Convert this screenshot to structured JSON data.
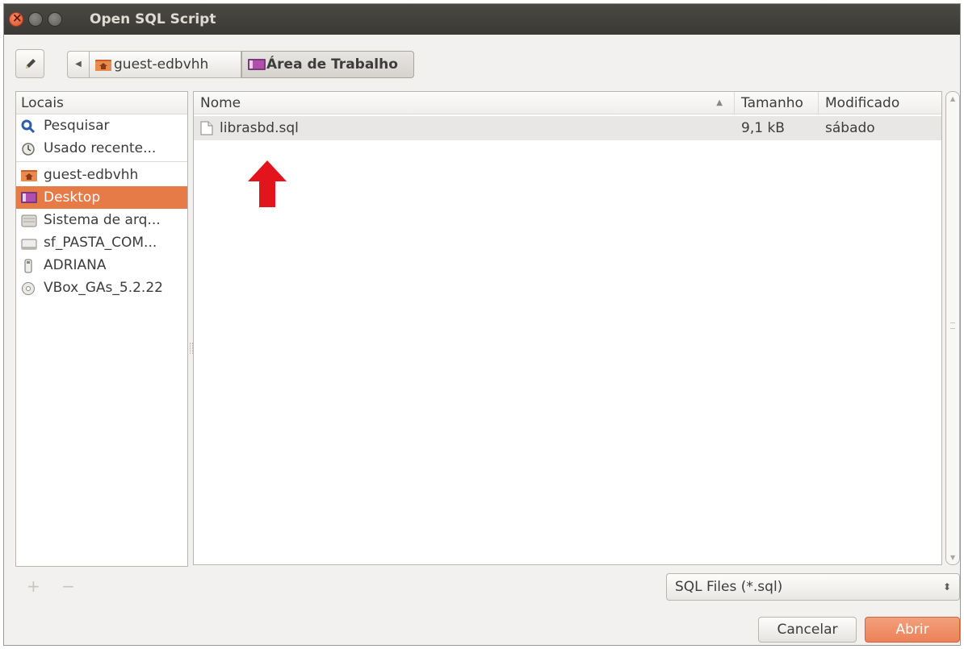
{
  "window": {
    "title": "Open SQL Script"
  },
  "pathbar": {
    "crumbs": [
      "guest-edbvhh",
      "Área de Trabalho"
    ]
  },
  "places": {
    "header": "Locais",
    "items": [
      {
        "label": "Pesquisar",
        "icon": "search-icon"
      },
      {
        "label": "Usado recente...",
        "icon": "recent-icon"
      },
      {
        "label": "guest-edbvhh",
        "icon": "home-folder-icon"
      },
      {
        "label": "Desktop",
        "icon": "desktop-icon",
        "selected": true
      },
      {
        "label": "Sistema de arq...",
        "icon": "drive-icon"
      },
      {
        "label": "sf_PASTA_COM...",
        "icon": "shared-folder-icon"
      },
      {
        "label": "ADRIANA",
        "icon": "usb-drive-icon"
      },
      {
        "label": "VBox_GAs_5.2.22",
        "icon": "optical-disc-icon"
      }
    ]
  },
  "filelist": {
    "columns": [
      "Nome",
      "Tamanho",
      "Modificado"
    ],
    "rows": [
      {
        "name": "librasbd.sql",
        "size": "9,1 kB",
        "modified": "sábado",
        "icon": "text-file-icon"
      }
    ]
  },
  "filter": {
    "selected": "SQL Files (*.sql)"
  },
  "buttons": {
    "cancel": "Cancelar",
    "open": "Abrir"
  },
  "colors": {
    "accent": "#e77b48",
    "annotation_arrow": "#e3141b"
  }
}
